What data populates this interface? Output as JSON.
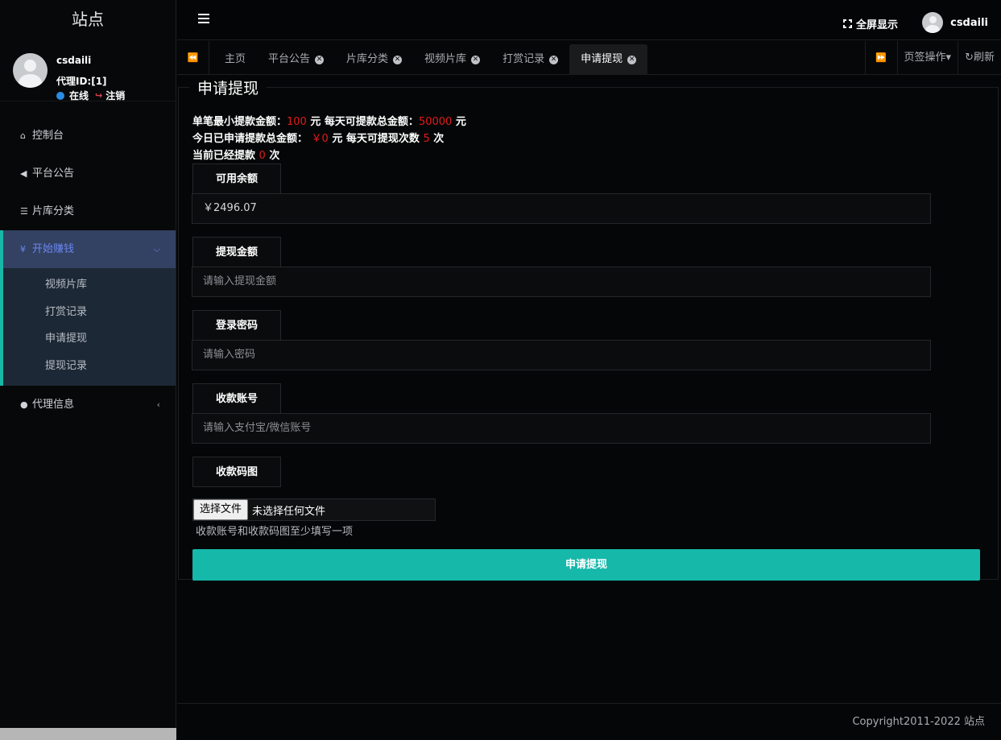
{
  "sidebar": {
    "logo": "站点",
    "user": {
      "name": "csdaili",
      "agent_id": "代理ID:[1]",
      "status": "在线",
      "logout": "注销"
    },
    "menu": [
      {
        "label": "控制台",
        "icon": "home-icon"
      },
      {
        "label": "平台公告",
        "icon": "bullhorn-icon"
      },
      {
        "label": "片库分类",
        "icon": "list-icon"
      },
      {
        "label": "开始赚钱",
        "icon": "yen-icon",
        "icon_glyph": "¥",
        "expanded": true,
        "children": [
          "视频片库",
          "打赏记录",
          "申请提现",
          "提现记录"
        ]
      },
      {
        "label": "代理信息",
        "icon": "user-icon"
      }
    ]
  },
  "topbar": {
    "fullscreen_label": "全屏显示",
    "username": "csdaili"
  },
  "tabs": {
    "items": [
      {
        "label": "主页",
        "closable": false
      },
      {
        "label": "平台公告",
        "closable": true
      },
      {
        "label": "片库分类",
        "closable": true
      },
      {
        "label": "视频片库",
        "closable": true
      },
      {
        "label": "打赏记录",
        "closable": true
      },
      {
        "label": "申请提现",
        "closable": true,
        "active": true
      }
    ],
    "tab_ops_label": "页签操作",
    "refresh_label": "刷新"
  },
  "main": {
    "title": "申请提现",
    "info": {
      "min_label": "单笔最小提款金额：",
      "min_value": "100",
      "yuan": "元",
      "daily_total_label": "每天可提款总金额：",
      "daily_total_value": "50000",
      "today_label": "今日已申请提款总金额：",
      "today_value": "￥0",
      "daily_count_label": "每天可提现次数",
      "daily_count_value": "5",
      "times": "次",
      "current_label": "当前已经提款",
      "current_value": "0"
    },
    "form": {
      "balance_label": "可用余额",
      "balance_value": "￥2496.07",
      "amount_label": "提现金额",
      "amount_placeholder": "请输入提现金额",
      "password_label": "登录密码",
      "password_placeholder": "请输入密码",
      "account_label": "收款账号",
      "account_placeholder": "请输入支付宝/微信账号",
      "qrcode_label": "收款码图",
      "file_button": "选择文件",
      "file_status": "未选择任何文件",
      "hint": "收款账号和收款码图至少填写一项",
      "submit": "申请提现"
    }
  },
  "footer": {
    "copyright": "Copyright2011-2022 站点"
  },
  "colors": {
    "accent": "#16b8aa",
    "menu_active_bg": "#334263",
    "menu_active_text": "#6b86f0",
    "highlight_red": "#e41a1a"
  }
}
